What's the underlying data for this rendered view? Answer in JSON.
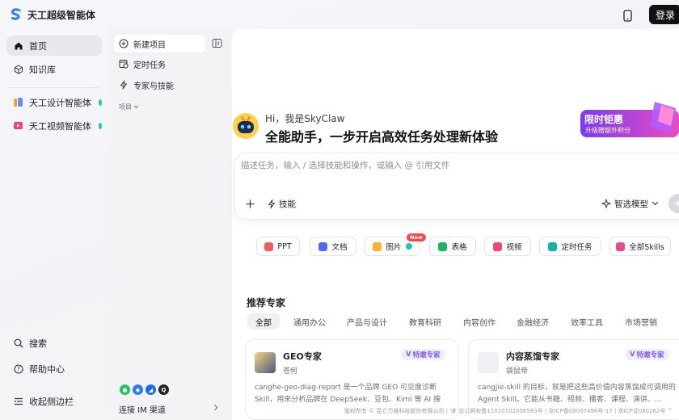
{
  "app": {
    "name": "天工超级智能体"
  },
  "topbar": {
    "login_label": "登录"
  },
  "nav": {
    "items": [
      {
        "label": "首页",
        "icon": "home-icon"
      },
      {
        "label": "知识库",
        "icon": "cube-icon"
      },
      {
        "label": "天工设计智能体",
        "icon": "design-agent-icon"
      },
      {
        "label": "天工视频智能体",
        "icon": "video-agent-icon"
      }
    ],
    "search_label": "搜索",
    "help_label": "帮助中心",
    "collapse_label": "收起侧边栏"
  },
  "panel": {
    "new_project": "新建项目",
    "scheduled_tasks": "定时任务",
    "experts_skills": "专家与技能",
    "projects_label": "项目",
    "im_label": "连接 IM 渠道"
  },
  "hero": {
    "greeting": "Hi，我是SkyClaw",
    "headline": "全能助手，一步开启高效任务处理新体验",
    "promo": {
      "title": "限时钜惠",
      "subtitle": "升级赠额外积分"
    }
  },
  "composer": {
    "placeholder": "描述任务，输入 / 选择技能和操作，或输入 @ 引用文件",
    "skills_label": "技能",
    "model_label": "智选模型"
  },
  "chips": [
    {
      "label": "PPT",
      "icon": "ppt-icon",
      "color": "#f15b5b"
    },
    {
      "label": "文档",
      "icon": "doc-icon",
      "color": "#4a6cf7"
    },
    {
      "label": "图片",
      "icon": "image-icon",
      "color": "#f5b331"
    },
    {
      "label": "表格",
      "icon": "sheet-icon",
      "color": "#1fb36a"
    },
    {
      "label": "视频",
      "icon": "video-icon",
      "color": "#f0457a"
    },
    {
      "label": "定时任务",
      "icon": "clock-icon",
      "color": "#12b5a5"
    },
    {
      "label": "全部Skills",
      "icon": "skills-icon",
      "color": "#e94c8a"
    }
  ],
  "new_badge": "New",
  "experts": {
    "title": "推荐专家",
    "tabs": [
      "全部",
      "通用办公",
      "产品与设计",
      "教育科研",
      "内容创作",
      "金融经济",
      "效率工具",
      "市场营销"
    ],
    "cards": [
      {
        "name": "GEO专家",
        "author": "苍何",
        "badge": "特邀专家",
        "desc": "canghe-geo-diag-report 是一个品牌 GEO 可见度诊断 Skill，用来分析品牌在 DeepSeek、豆包、Kimi 等 AI 搜索..."
      },
      {
        "name": "内容蒸馏专家",
        "author": "袋鼠帝",
        "badge": "特邀专家",
        "desc": "cangjie-skill 的目标，就是把这些高价值内容蒸馏成可调用的 Agent Skill。它能从书籍、视频、播客、课程、演讲、..."
      }
    ]
  },
  "footer": {
    "text": "版权所有 © 昆仑万维科技股份有限公司 | 🛡 京公网安备11010102006563号 | 京ICP备09007496号-17 | 京ICP证080262号 ^"
  }
}
